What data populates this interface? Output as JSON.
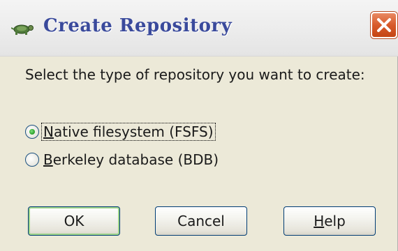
{
  "window": {
    "title": "Create Repository",
    "title_icon": "turtle-icon",
    "close_icon": "close-icon"
  },
  "prompt": "Select the type of repository you want to create:",
  "options": [
    {
      "pre": "",
      "accel": "N",
      "post": "ative filesystem (FSFS)",
      "selected": true
    },
    {
      "pre": "",
      "accel": "B",
      "post": "erkeley database (BDB)",
      "selected": false
    }
  ],
  "buttons": {
    "ok": {
      "label": "OK"
    },
    "cancel": {
      "label": "Cancel"
    },
    "help": {
      "accel": "H",
      "rest": "elp"
    }
  },
  "colors": {
    "title_text": "#3a4a9c",
    "close_button": "#d85a2a",
    "dialog_bg": "#ece9d8",
    "radio_selected": "#2fa52f"
  }
}
